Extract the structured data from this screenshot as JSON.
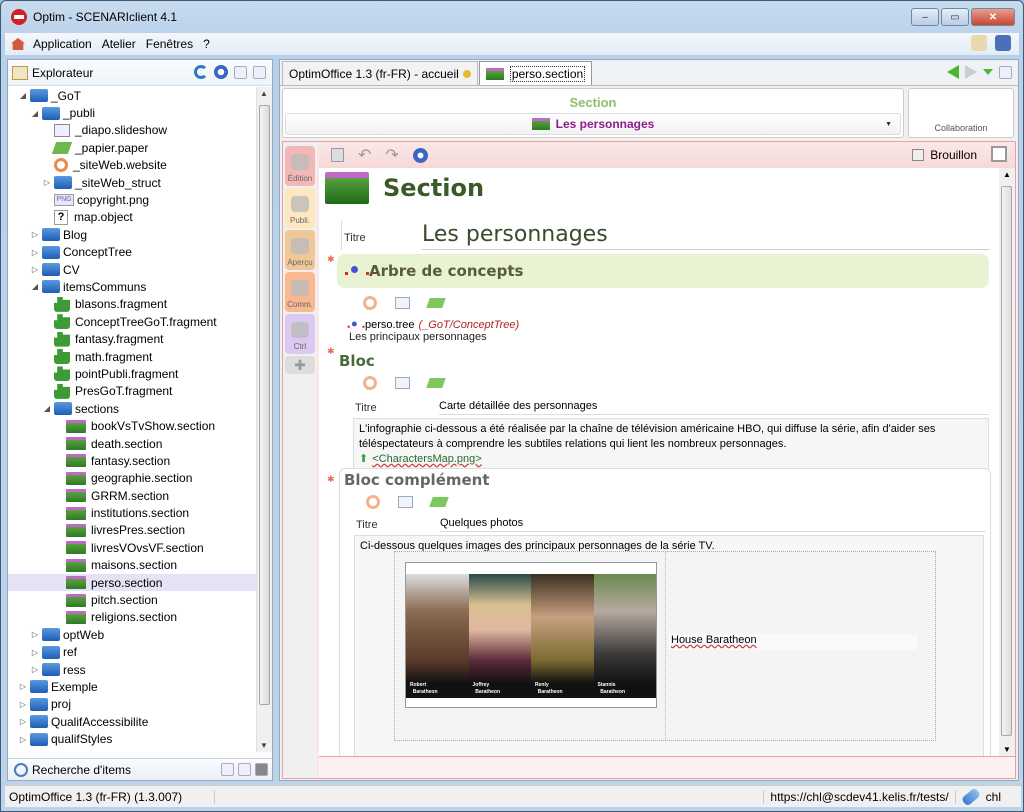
{
  "window": {
    "title": "Optim - SCENARIclient 4.1",
    "controls": {
      "minimize": "–",
      "maximize": "▭",
      "close": "✕"
    }
  },
  "menu": {
    "items": [
      "Application",
      "Atelier",
      "Fenêtres",
      "?"
    ]
  },
  "explorer": {
    "title": "Explorateur",
    "tree": [
      {
        "label": "_GoT",
        "type": "folder",
        "depth": 0,
        "expanded": true
      },
      {
        "label": "_publi",
        "type": "folder",
        "depth": 1,
        "expanded": true
      },
      {
        "label": "_diapo.slideshow",
        "type": "slideshow",
        "depth": 2
      },
      {
        "label": "_papier.paper",
        "type": "paper",
        "depth": 2
      },
      {
        "label": "_siteWeb.website",
        "type": "website",
        "depth": 2
      },
      {
        "label": "_siteWeb_struct",
        "type": "folder",
        "depth": 2,
        "expanded": false
      },
      {
        "label": "copyright.png",
        "type": "png",
        "depth": 2
      },
      {
        "label": "map.object",
        "type": "object",
        "depth": 2
      },
      {
        "label": "Blog",
        "type": "folder",
        "depth": 1,
        "expanded": false
      },
      {
        "label": "ConceptTree",
        "type": "folder",
        "depth": 1,
        "expanded": false
      },
      {
        "label": "CV",
        "type": "folder",
        "depth": 1,
        "expanded": false
      },
      {
        "label": "itemsCommuns",
        "type": "folder",
        "depth": 1,
        "expanded": true
      },
      {
        "label": "blasons.fragment",
        "type": "fragment",
        "depth": 2
      },
      {
        "label": "ConceptTreeGoT.fragment",
        "type": "fragment",
        "depth": 2
      },
      {
        "label": "fantasy.fragment",
        "type": "fragment",
        "depth": 2
      },
      {
        "label": "math.fragment",
        "type": "fragment",
        "depth": 2
      },
      {
        "label": "pointPubli.fragment",
        "type": "fragment",
        "depth": 2
      },
      {
        "label": "PresGoT.fragment",
        "type": "fragment",
        "depth": 2
      },
      {
        "label": "sections",
        "type": "folder",
        "depth": 2,
        "expanded": true
      },
      {
        "label": "bookVsTvShow.section",
        "type": "section",
        "depth": 3
      },
      {
        "label": "death.section",
        "type": "section",
        "depth": 3
      },
      {
        "label": "fantasy.section",
        "type": "section",
        "depth": 3
      },
      {
        "label": "geographie.section",
        "type": "section",
        "depth": 3
      },
      {
        "label": "GRRM.section",
        "type": "section",
        "depth": 3
      },
      {
        "label": "institutions.section",
        "type": "section",
        "depth": 3
      },
      {
        "label": "livresPres.section",
        "type": "section",
        "depth": 3
      },
      {
        "label": "livresVOvsVF.section",
        "type": "section",
        "depth": 3
      },
      {
        "label": "maisons.section",
        "type": "section",
        "depth": 3
      },
      {
        "label": "perso.section",
        "type": "section",
        "depth": 3,
        "selected": true
      },
      {
        "label": "pitch.section",
        "type": "section",
        "depth": 3
      },
      {
        "label": "religions.section",
        "type": "section",
        "depth": 3
      },
      {
        "label": "optWeb",
        "type": "folder",
        "depth": 1,
        "expanded": false
      },
      {
        "label": "ref",
        "type": "folder",
        "depth": 1,
        "expanded": false
      },
      {
        "label": "ress",
        "type": "folder",
        "depth": 1,
        "expanded": false
      },
      {
        "label": "Exemple",
        "type": "folder",
        "depth": 0,
        "expanded": false
      },
      {
        "label": "proj",
        "type": "folder",
        "depth": 0,
        "expanded": false
      },
      {
        "label": "QualifAccessibilite",
        "type": "folder",
        "depth": 0,
        "expanded": false
      },
      {
        "label": "qualifStyles",
        "type": "folder",
        "depth": 0,
        "expanded": false
      }
    ],
    "search_label": "Recherche d'items"
  },
  "tabs": [
    {
      "label": "OptimOffice 1.3 (fr-FR) - accueil",
      "active": false
    },
    {
      "label": "perso.section",
      "active": true
    }
  ],
  "header": {
    "model": "Section",
    "item_title": "Les personnages",
    "collaboration": "Collaboration"
  },
  "side_tabs": [
    "Édition",
    "Publi.",
    "Aperçu",
    "Comm.",
    "Ctrl"
  ],
  "editor": {
    "draft_label": "Brouillon",
    "draft_checked": false,
    "section_label": "Section",
    "titre_label": "Titre",
    "title_value": "Les personnages",
    "concept": {
      "title": "Arbre de concepts",
      "ref_name": "perso.tree",
      "ref_path": "(_GoT/ConceptTree)",
      "ref_desc": "Les principaux personnages"
    },
    "bloc": {
      "heading": "Bloc",
      "titre_value": "Carte détaillée des personnages",
      "text": "L'infographie ci-dessous a été réalisée par la chaîne de télévision américaine HBO, qui diffuse la série, afin d'aider ses téléspectateurs à comprendre les subtiles relations qui lient les nombreux personnages.",
      "resource": "<CharactersMap.png>"
    },
    "complement": {
      "heading": "Bloc complément",
      "titre_value": "Quelques photos",
      "text": "Ci-dessous quelques images des principaux personnages de la série TV.",
      "photo_captions": [
        {
          "first": "Robert",
          "last": "Baratheon"
        },
        {
          "first": "Joffrey",
          "last": "Baratheon"
        },
        {
          "first": "Renly",
          "last": "Baratheon"
        },
        {
          "first": "Stannis",
          "last": "Baratheon"
        }
      ],
      "image_caption": "House Baratheon"
    }
  },
  "status": {
    "left": "OptimOffice 1.3 (fr-FR) (1.3.007)",
    "url": "https://chl@scdev41.kelis.fr/tests/",
    "user": "chl"
  },
  "colors": {
    "accent_green": "#8abf6c",
    "item_purple": "#8a1e8a",
    "editor_pink": "#fbe6e6",
    "concept_bg": "#eaf2d4"
  }
}
